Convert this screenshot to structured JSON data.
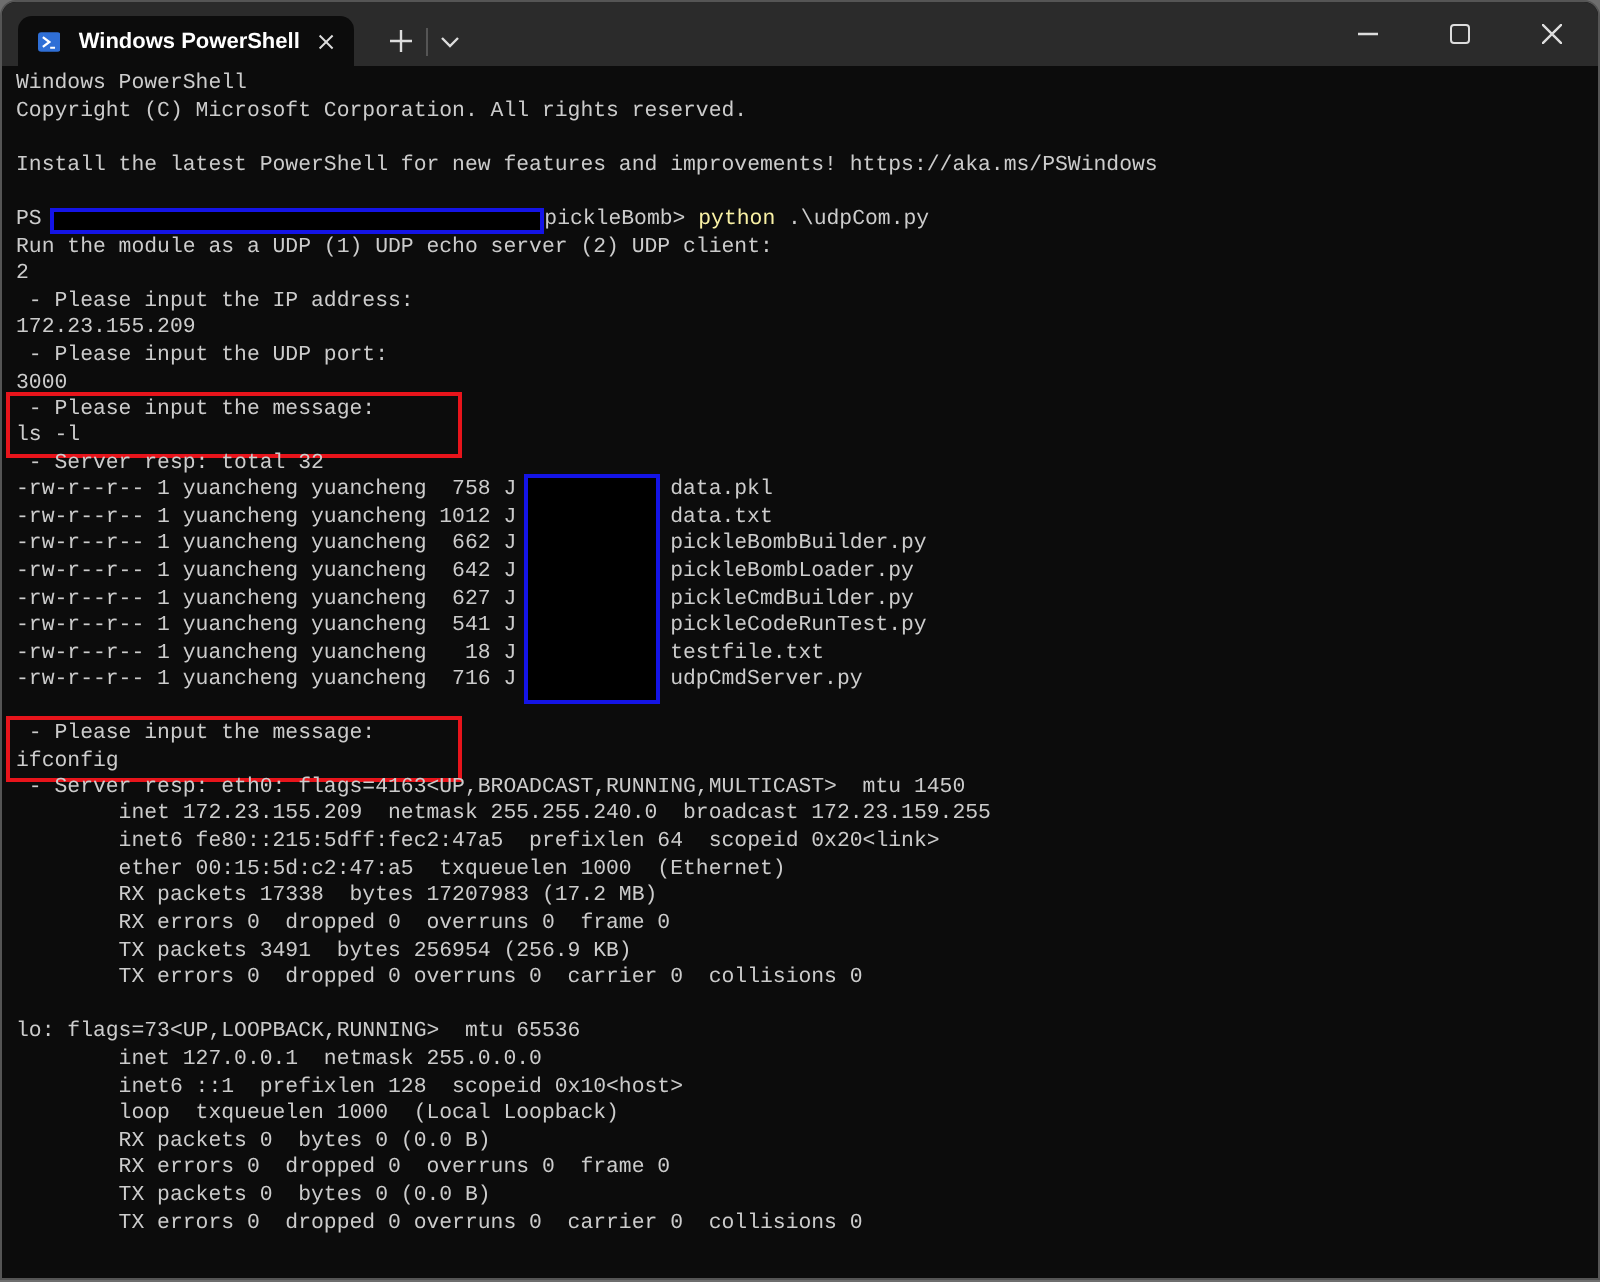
{
  "tabs": [
    {
      "label": "Windows PowerShell",
      "selected": true
    }
  ],
  "terminal": {
    "lines": [
      {
        "kind": "text",
        "text": "Windows PowerShell"
      },
      {
        "kind": "text",
        "text": "Copyright (C) Microsoft Corporation. All rights reserved."
      },
      {
        "kind": "blank"
      },
      {
        "kind": "text",
        "text": "Install the latest PowerShell for new features and improvements! https://aka.ms/PSWindows"
      },
      {
        "kind": "blank"
      },
      {
        "kind": "prompt",
        "prefix": "PS",
        "redacted": true,
        "path_tail": "pickleBomb>",
        "command": "python",
        "args": ".\\udpCom.py"
      },
      {
        "kind": "text",
        "text": "Run the module as a UDP (1) UDP echo server (2) UDP client:"
      },
      {
        "kind": "text",
        "text": "2"
      },
      {
        "kind": "text",
        "text": " - Please input the IP address:"
      },
      {
        "kind": "text",
        "text": "172.23.155.209"
      },
      {
        "kind": "text",
        "text": " - Please input the UDP port:"
      },
      {
        "kind": "text",
        "text": "3000"
      },
      {
        "kind": "highlight",
        "lines": [
          " - Please input the message:",
          "ls -l"
        ]
      },
      {
        "kind": "text",
        "text": " - Server resp: total 32"
      },
      {
        "kind": "listing",
        "redacted": true,
        "rows": [
          {
            "prefix": "-rw-r--r-- 1 yuancheng yuancheng  758 J",
            "name": "data.pkl"
          },
          {
            "prefix": "-rw-r--r-- 1 yuancheng yuancheng 1012 J",
            "name": "data.txt"
          },
          {
            "prefix": "-rw-r--r-- 1 yuancheng yuancheng  662 J",
            "name": "pickleBombBuilder.py"
          },
          {
            "prefix": "-rw-r--r-- 1 yuancheng yuancheng  642 J",
            "name": "pickleBombLoader.py"
          },
          {
            "prefix": "-rw-r--r-- 1 yuancheng yuancheng  627 J",
            "name": "pickleCmdBuilder.py"
          },
          {
            "prefix": "-rw-r--r-- 1 yuancheng yuancheng  541 J",
            "name": "pickleCodeRunTest.py"
          },
          {
            "prefix": "-rw-r--r-- 1 yuancheng yuancheng   18 J",
            "name": "testfile.txt"
          },
          {
            "prefix": "-rw-r--r-- 1 yuancheng yuancheng  716 J",
            "name": "udpCmdServer.py"
          }
        ]
      },
      {
        "kind": "blank"
      },
      {
        "kind": "highlight",
        "lines": [
          " - Please input the message:",
          "ifconfig"
        ]
      },
      {
        "kind": "text",
        "text": " - Server resp: eth0: flags=4163<UP,BROADCAST,RUNNING,MULTICAST>  mtu 1450"
      },
      {
        "kind": "text",
        "text": "        inet 172.23.155.209  netmask 255.255.240.0  broadcast 172.23.159.255"
      },
      {
        "kind": "text",
        "text": "        inet6 fe80::215:5dff:fec2:47a5  prefixlen 64  scopeid 0x20<link>"
      },
      {
        "kind": "text",
        "text": "        ether 00:15:5d:c2:47:a5  txqueuelen 1000  (Ethernet)"
      },
      {
        "kind": "text",
        "text": "        RX packets 17338  bytes 17207983 (17.2 MB)"
      },
      {
        "kind": "text",
        "text": "        RX errors 0  dropped 0  overruns 0  frame 0"
      },
      {
        "kind": "text",
        "text": "        TX packets 3491  bytes 256954 (256.9 KB)"
      },
      {
        "kind": "text",
        "text": "        TX errors 0  dropped 0 overruns 0  carrier 0  collisions 0"
      },
      {
        "kind": "blank"
      },
      {
        "kind": "text",
        "text": "lo: flags=73<UP,LOOPBACK,RUNNING>  mtu 65536"
      },
      {
        "kind": "text",
        "text": "        inet 127.0.0.1  netmask 255.0.0.0"
      },
      {
        "kind": "text",
        "text": "        inet6 ::1  prefixlen 128  scopeid 0x10<host>"
      },
      {
        "kind": "text",
        "text": "        loop  txqueuelen 1000  (Local Loopback)"
      },
      {
        "kind": "text",
        "text": "        RX packets 0  bytes 0 (0.0 B)"
      },
      {
        "kind": "text",
        "text": "        RX errors 0  dropped 0  overruns 0  frame 0"
      },
      {
        "kind": "text",
        "text": "        TX packets 0  bytes 0 (0.0 B)"
      },
      {
        "kind": "text",
        "text": "        TX errors 0  dropped 0 overruns 0  carrier 0  collisions 0"
      }
    ]
  }
}
